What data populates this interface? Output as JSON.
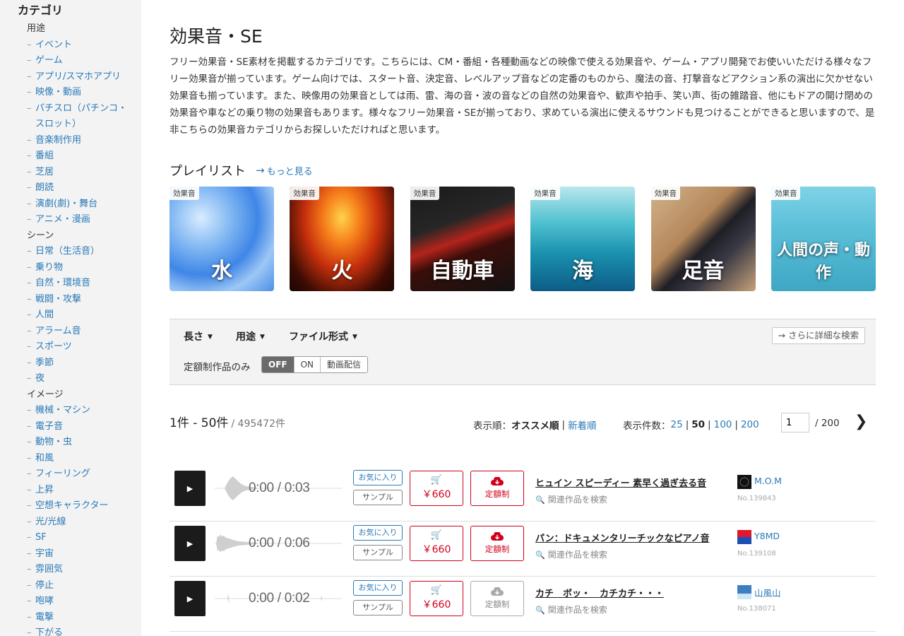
{
  "sidebar": {
    "title": "カテゴリ",
    "groups": [
      {
        "label": "用途",
        "items": [
          "イベント",
          "ゲーム",
          "アプリ/スマホアプリ",
          "映像・動画",
          "パチスロ（パチンコ・スロット）",
          "音楽制作用",
          "番組",
          "芝居",
          "朗読",
          "演劇(劇)・舞台",
          "アニメ・漫画"
        ]
      },
      {
        "label": "シーン",
        "items": [
          "日常（生活音）",
          "乗り物",
          "自然・環境音",
          "戦闘・攻撃",
          "人間",
          "アラーム音",
          "スポーツ",
          "季節",
          "夜"
        ]
      },
      {
        "label": "イメージ",
        "items": [
          "機械・マシン",
          "電子音",
          "動物・虫",
          "和風",
          "フィーリング",
          "上昇",
          "空想キャラクター",
          "光/光線",
          "SF",
          "宇宙",
          "雰囲気",
          "停止",
          "咆哮",
          "電撃",
          "下がる"
        ]
      }
    ]
  },
  "main": {
    "title": "効果音・SE",
    "description": "フリー効果音・SE素材を掲載するカテゴリです。こちらには、CM・番組・各種動画などの映像で使える効果音や、ゲーム・アプリ開発でお使いいただける様々なフリー効果音が揃っています。ゲーム向けでは、スタート音、決定音、レベルアップ音などの定番のものから、魔法の音、打撃音などアクション系の演出に欠かせない効果音も揃っています。また、映像用の効果音としては雨、雷、海の音・波の音などの自然の効果音や、歓声や拍手、笑い声、街の雑踏音、他にもドアの開け閉めの効果音や車などの乗り物の効果音もあります。様々なフリー効果音・SEが揃っており、求めている演出に使えるサウンドも見つけることができると思いますので、是非こちらの効果音カテゴリからお探しいただければと思います。"
  },
  "playlist": {
    "title": "プレイリスト",
    "more": "もっと見る",
    "tag": "効果音",
    "cards": [
      "水",
      "火",
      "自動車",
      "海",
      "足音",
      "人間の声・動作"
    ]
  },
  "filter": {
    "length": "長さ",
    "usage": "用途",
    "format": "ファイル形式",
    "advanced": "さらに詳細な検索",
    "flat_label": "定額制作品のみ",
    "toggle": [
      "OFF",
      "ON",
      "動画配信"
    ]
  },
  "results": {
    "range": "1件 - 50件",
    "total": "/ 495472件",
    "sort_label": "表示順：",
    "sort_current": "オススメ順",
    "sort_other": "新着順",
    "per_label": "表示件数：",
    "per_options": [
      "25",
      "50",
      "100",
      "200"
    ],
    "page": "1",
    "page_total": "/ 200"
  },
  "tracks": [
    {
      "time": "0:00 / 0:03",
      "fav": "お気に入り",
      "sample": "サンプル",
      "price": "￥660",
      "flat": "定額制",
      "title": "ヒュイン スピーディー 素早く過ぎ去る音",
      "related": "関連作品を検索",
      "artist": "M.O.M",
      "no": "No.139843"
    },
    {
      "time": "0:00 / 0:06",
      "fav": "お気に入り",
      "sample": "サンプル",
      "price": "￥660",
      "flat": "定額制",
      "title": "パン：ドキュメンタリーチックなピアノ音",
      "related": "関連作品を検索",
      "artist": "Y8MD",
      "no": "No.139108"
    },
    {
      "time": "0:00 / 0:02",
      "fav": "お気に入り",
      "sample": "サンプル",
      "price": "￥660",
      "flat": "定額制",
      "title": "カチ　ボッ・　カチカチ・・・",
      "related": "関連作品を検索",
      "artist": "山風山",
      "no": "No.138071"
    }
  ],
  "colors": {
    "link": "#2a7ab8",
    "buy": "#d0021b",
    "sidebar_bg": "#f3f3f3"
  }
}
